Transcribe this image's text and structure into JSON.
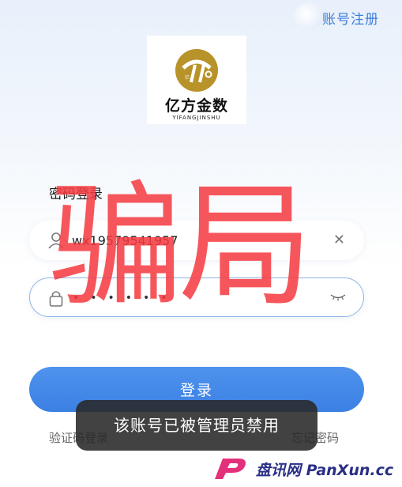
{
  "header": {
    "register_link": "账号注册"
  },
  "brand": {
    "name": "亿方金数",
    "subtitle": "YIFANGJINSHU",
    "logo_icon": "gold-circle-logo-icon"
  },
  "login": {
    "title": "密码登录",
    "username_value": "wx19579541957",
    "password_mask": "••••••",
    "submit_label": "登录",
    "sms_login_link": "验证码登录",
    "forgot_password_link": "忘记密码"
  },
  "toast": {
    "message": "该账号已被管理员禁用"
  },
  "overlay": {
    "scam_text": "骗局"
  },
  "watermark": {
    "text": "盘讯网 PanXun.cc"
  },
  "colors": {
    "accent": "#3d7ddb",
    "button": "#4388ea",
    "overlay_red": "#f53a40",
    "watermark": "#2a2f86"
  }
}
